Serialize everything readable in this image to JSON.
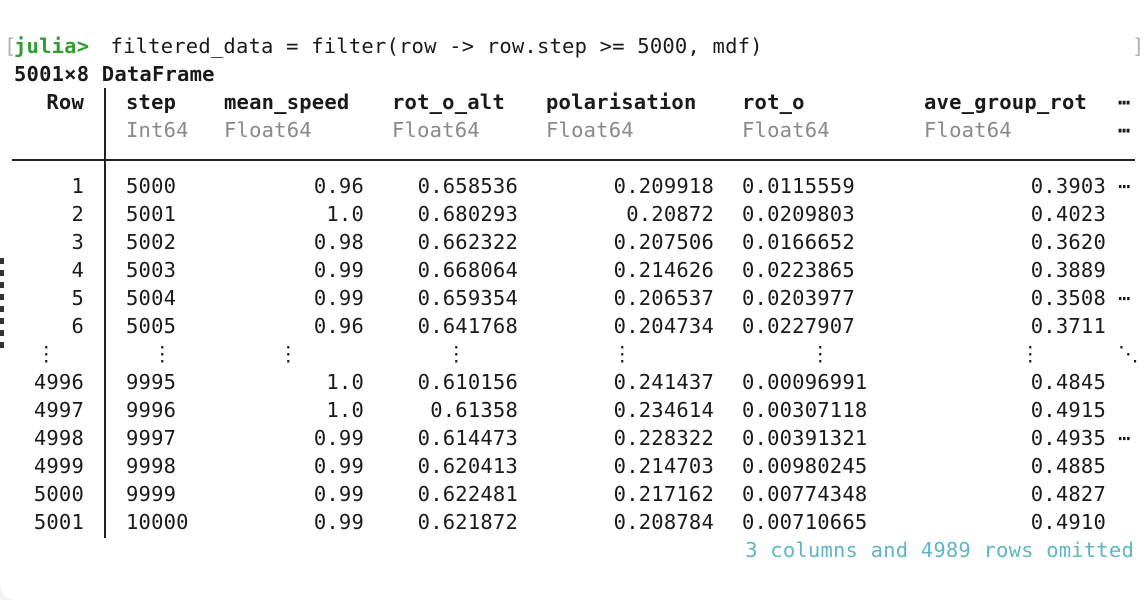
{
  "prompt": {
    "open_bracket": "[",
    "label": "julia>",
    "command": " filtered_data = filter(row -> row.step >= 5000, mdf)",
    "close_bracket": "]"
  },
  "summary": "5001×8 DataFrame",
  "columns": [
    {
      "name": "Row",
      "type": ""
    },
    {
      "name": "step",
      "type": "Int64"
    },
    {
      "name": "mean_speed",
      "type": "Float64"
    },
    {
      "name": "rot_o_alt",
      "type": "Float64"
    },
    {
      "name": "polarisation",
      "type": "Float64"
    },
    {
      "name": "rot_o",
      "type": "Float64"
    },
    {
      "name": "ave_group_rot",
      "type": "Float64"
    }
  ],
  "header_more": "⋯",
  "rows_top": [
    {
      "row": "1",
      "step": "5000",
      "mean_speed": "0.96",
      "rot_o_alt": "0.658536",
      "polarisation": "0.209918",
      "rot_o": "0.0115559",
      "ave_group_rot": "0.3903",
      "more": "⋯"
    },
    {
      "row": "2",
      "step": "5001",
      "mean_speed": "1.0",
      "rot_o_alt": "0.680293",
      "polarisation": "0.20872",
      "rot_o": "0.0209803",
      "ave_group_rot": "0.4023",
      "more": ""
    },
    {
      "row": "3",
      "step": "5002",
      "mean_speed": "0.98",
      "rot_o_alt": "0.662322",
      "polarisation": "0.207506",
      "rot_o": "0.0166652",
      "ave_group_rot": "0.3620",
      "more": ""
    },
    {
      "row": "4",
      "step": "5003",
      "mean_speed": "0.99",
      "rot_o_alt": "0.668064",
      "polarisation": "0.214626",
      "rot_o": "0.0223865",
      "ave_group_rot": "0.3889",
      "more": ""
    },
    {
      "row": "5",
      "step": "5004",
      "mean_speed": "0.99",
      "rot_o_alt": "0.659354",
      "polarisation": "0.206537",
      "rot_o": "0.0203977",
      "ave_group_rot": "0.3508",
      "more": "⋯"
    },
    {
      "row": "6",
      "step": "5005",
      "mean_speed": "0.96",
      "rot_o_alt": "0.641768",
      "polarisation": "0.204734",
      "rot_o": "0.0227907",
      "ave_group_rot": "0.3711",
      "more": ""
    }
  ],
  "vdots": "⋮",
  "ddots": "⋱",
  "rows_bottom": [
    {
      "row": "4996",
      "step": "9995",
      "mean_speed": "1.0",
      "rot_o_alt": "0.610156",
      "polarisation": "0.241437",
      "rot_o": "0.00096991",
      "ave_group_rot": "0.4845",
      "more": ""
    },
    {
      "row": "4997",
      "step": "9996",
      "mean_speed": "1.0",
      "rot_o_alt": "0.61358",
      "polarisation": "0.234614",
      "rot_o": "0.00307118",
      "ave_group_rot": "0.4915",
      "more": ""
    },
    {
      "row": "4998",
      "step": "9997",
      "mean_speed": "0.99",
      "rot_o_alt": "0.614473",
      "polarisation": "0.228322",
      "rot_o": "0.00391321",
      "ave_group_rot": "0.4935",
      "more": "⋯"
    },
    {
      "row": "4999",
      "step": "9998",
      "mean_speed": "0.99",
      "rot_o_alt": "0.620413",
      "polarisation": "0.214703",
      "rot_o": "0.00980245",
      "ave_group_rot": "0.4885",
      "more": ""
    },
    {
      "row": "5000",
      "step": "9999",
      "mean_speed": "0.99",
      "rot_o_alt": "0.622481",
      "polarisation": "0.217162",
      "rot_o": "0.00774348",
      "ave_group_rot": "0.4827",
      "more": ""
    },
    {
      "row": "5001",
      "step": "10000",
      "mean_speed": "0.99",
      "rot_o_alt": "0.621872",
      "polarisation": "0.208784",
      "rot_o": "0.00710665",
      "ave_group_rot": "0.4910",
      "more": ""
    }
  ],
  "omitted_note": "3 columns and 4989 rows omitted"
}
